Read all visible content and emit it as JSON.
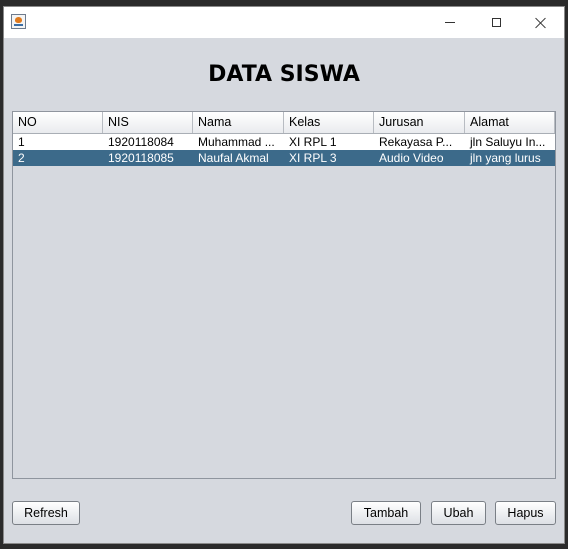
{
  "window": {
    "title": "",
    "icon": "java-cup-icon",
    "controls": {
      "minimize": "minimize-icon",
      "maximize": "maximize-icon",
      "close": "close-icon"
    }
  },
  "heading": "DATA SISWA",
  "table": {
    "columns": [
      "NO",
      "NIS",
      "Nama",
      "Kelas",
      "Jurusan",
      "Alamat"
    ],
    "rows": [
      [
        "1",
        "1920118084",
        "Muhammad ...",
        "XI RPL 1",
        "Rekayasa P...",
        "jln Saluyu In..."
      ],
      [
        "2",
        "1920118085",
        "Naufal Akmal",
        "XI RPL 3",
        "Audio Video",
        "jln yang lurus"
      ]
    ],
    "selected_row": 2
  },
  "buttons": {
    "refresh": "Refresh",
    "tambah": "Tambah",
    "ubah": "Ubah",
    "hapus": "Hapus"
  },
  "colors": {
    "window_bg": "#d6d9df",
    "selection": "#3c6a8a"
  }
}
